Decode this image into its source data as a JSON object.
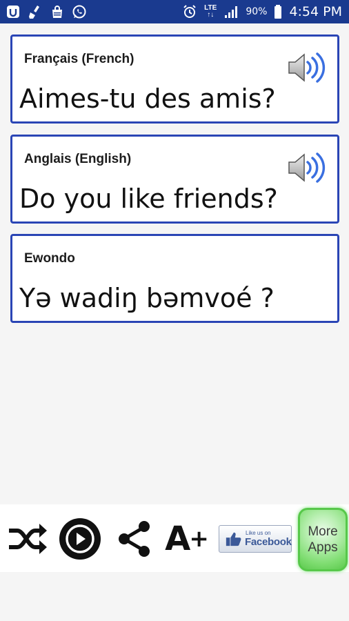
{
  "status_bar": {
    "battery_percent": "90%",
    "time": "4:54 PM",
    "network": [
      "LTE",
      "↑↓"
    ],
    "icons": [
      "app-notification-icon",
      "cleaner-icon",
      "shopping-bag-icon",
      "whatsapp-icon",
      "alarm-icon",
      "signal-icon",
      "battery-icon"
    ]
  },
  "cards": [
    {
      "label": "Français (French)",
      "text": "Aimes-tu des amis?",
      "has_speaker": true
    },
    {
      "label": "Anglais (English)",
      "text": "Do you like friends?",
      "has_speaker": true
    },
    {
      "label": "Ewondo",
      "text": "Yə wadiŋ bəmvoé ?",
      "has_speaker": false
    }
  ],
  "toolbar": {
    "font_button": {
      "letter": "A",
      "plus": "+"
    },
    "facebook": {
      "small": "Like us on",
      "big": "Facebook"
    },
    "more_apps": {
      "line1": "More",
      "line2": "Apps"
    }
  },
  "colors": {
    "status_bar": "#1a3a8f",
    "card_border": "#2a45b5",
    "speaker_waves": "#3a6fe0",
    "more_apps_green": "#7ddc6f"
  }
}
